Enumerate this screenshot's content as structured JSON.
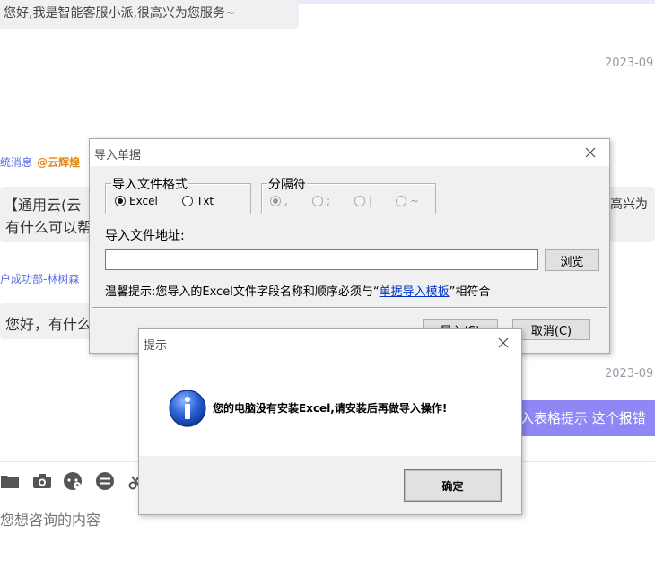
{
  "chat": {
    "greeting": "您好,我是智能客服小派,很高兴为您服务~",
    "timestamp_1": "2023-09",
    "system_msg_prefix": "统消息",
    "system_msg_mention": "@云辉煌",
    "message_1_line1": "【通用云(云",
    "message_1_line1_tail": "高兴为",
    "message_1_line2": "有什么可以帮",
    "sender": "户成功部-林树森",
    "message_2": "您好，有什么",
    "timestamp_2": "2023-09",
    "user_message": "入表格提示 这个报错",
    "input_placeholder": "您想咨询的内容",
    "toolbar_icons": [
      "folder-icon",
      "camera-icon",
      "support-chat-icon",
      "exchange-icon",
      "scissors-icon"
    ]
  },
  "import_dialog": {
    "title": "导入单据",
    "format_group": {
      "legend": "导入文件格式",
      "options": [
        "Excel",
        "Txt"
      ],
      "selected": "Excel"
    },
    "separator_group": {
      "legend": "分隔符",
      "options": [
        ",",
        ";",
        "|",
        "~"
      ],
      "selected": ","
    },
    "path_label": "导入文件地址:",
    "path_value": "",
    "browse_button": "浏览",
    "hint_prefix": "温馨提示:您导入的Excel文件字段名称和顺序必须与“",
    "hint_link": "单据导入模板",
    "hint_suffix": "”相符合",
    "import_button": "导入(S)",
    "cancel_button": "取消(C)"
  },
  "alert_dialog": {
    "title": "提示",
    "message": "您的电脑没有安装Excel,请安装后再做导入操作!",
    "ok_button": "确定",
    "icon": "info-icon"
  }
}
